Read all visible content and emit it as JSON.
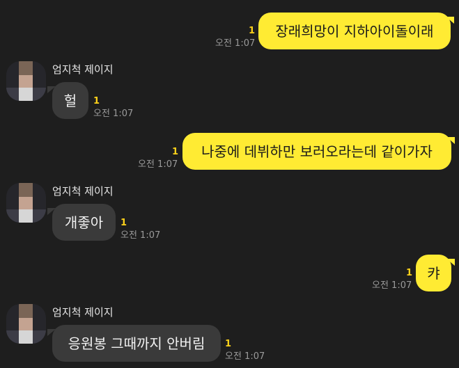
{
  "colors": {
    "background": "#1e1e1e",
    "outgoing_bubble": "#ffeb33",
    "incoming_bubble": "#3a3a3a",
    "unread": "#ffd21a",
    "time": "#9a9a9a"
  },
  "messages": [
    {
      "direction": "out",
      "text": "장래희망이 지하아이돌이래",
      "unread": "1",
      "time": "오전 1:07"
    },
    {
      "direction": "in",
      "sender": "엄지척 제이지",
      "text": "헐",
      "unread": "1",
      "time": "오전 1:07"
    },
    {
      "direction": "out",
      "text": "나중에 데뷔하만 보러오라는데 같이가자",
      "unread": "1",
      "time": "오전 1:07"
    },
    {
      "direction": "in",
      "sender": "엄지척 제이지",
      "text": "개좋아",
      "unread": "1",
      "time": "오전 1:07"
    },
    {
      "direction": "out",
      "text": "캬",
      "unread": "1",
      "time": "오전 1:07"
    },
    {
      "direction": "in",
      "sender": "엄지척 제이지",
      "text": "응원봉 그때까지 안버림",
      "unread": "1",
      "time": "오전 1:07"
    }
  ]
}
